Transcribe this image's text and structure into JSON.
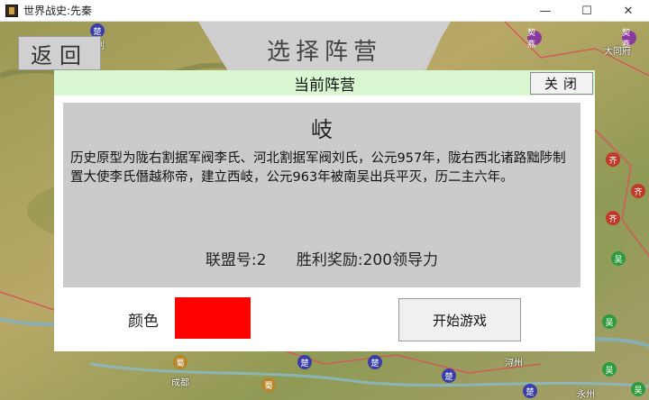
{
  "window": {
    "title": "世界战史:先秦",
    "controls": {
      "minimize": "—",
      "maximize": "☐",
      "close": "✕"
    }
  },
  "nav": {
    "back_label": "返回",
    "banner_title": "选择阵营"
  },
  "dialog": {
    "header": "当前阵营",
    "close_label": "关闭",
    "faction_name": "岐",
    "description": "历史原型为陇右割据军阀李氏、河北割据军阀刘氏，公元957年，陇右西北诸路黜陟制置大使李氏僭越称帝，建立西岐，公元963年被南吴出兵平灭，历二主六年。",
    "alliance_text": "联盟号:2",
    "reward_text": "胜利奖励:200领导力",
    "color_label": "颜色",
    "faction_color": "#ff0000",
    "start_label": "开始游戏"
  },
  "map_markers": [
    {
      "label": "契燕",
      "color": "#8a3a9a"
    },
    {
      "label": "契燕",
      "color": "#8a3a9a"
    },
    {
      "label": "齐",
      "color": "#c0392b"
    },
    {
      "label": "齐",
      "color": "#c0392b"
    },
    {
      "label": "齐",
      "color": "#c0392b"
    },
    {
      "label": "吴",
      "color": "#2e9c3e"
    },
    {
      "label": "吴",
      "color": "#2e9c3e"
    },
    {
      "label": "吴",
      "color": "#2e9c3e"
    },
    {
      "label": "吴",
      "color": "#2e9c3e"
    },
    {
      "label": "楚",
      "color": "#3a3fa8"
    },
    {
      "label": "楚",
      "color": "#3a3fa8"
    },
    {
      "label": "楚",
      "color": "#3a3fa8"
    },
    {
      "label": "楚",
      "color": "#3a3fa8"
    },
    {
      "label": "蜀",
      "color": "#b8862b"
    },
    {
      "label": "蜀",
      "color": "#b8862b"
    },
    {
      "label": "楚",
      "color": "#3a3fa8"
    }
  ],
  "map_places": [
    "成都",
    "浔州",
    "永州",
    "大同府",
    "析利"
  ]
}
